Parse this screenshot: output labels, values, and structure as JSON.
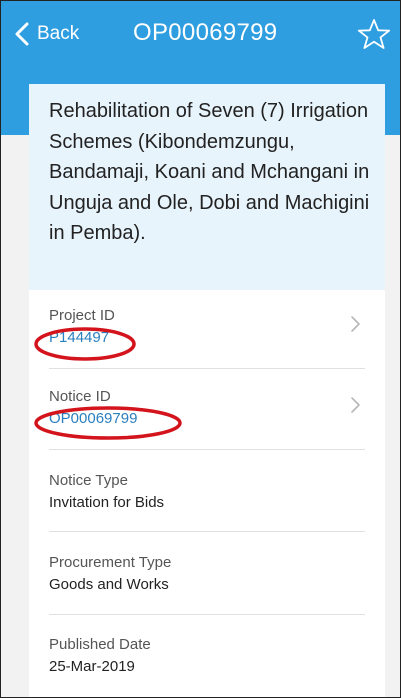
{
  "nav": {
    "back_label": "Back",
    "title": "OP00069799"
  },
  "notice": {
    "title": "Rehabilitation of Seven (7) Irrigation Schemes (Kibondemzungu, Bandamaji, Koani and Mchangani in Unguja and Ole, Dobi and Machigini in Pemba).",
    "fields": [
      {
        "label": "Project ID",
        "value": "P144497"
      },
      {
        "label": "Notice ID",
        "value": "OP00069799"
      },
      {
        "label": "Notice Type",
        "value": "Invitation for Bids"
      },
      {
        "label": "Procurement Type",
        "value": "Goods and Works"
      },
      {
        "label": "Published Date",
        "value": "25-Mar-2019"
      }
    ]
  },
  "icons": {
    "back": "chevron-left-icon",
    "favorite": "star-outline-icon",
    "row_chevron": "chevron-right-icon"
  },
  "colors": {
    "header": "#2f9ee0",
    "title_block": "#e8f4fc",
    "link": "#2a7fbf",
    "highlight_ellipse": "#d4141c"
  }
}
